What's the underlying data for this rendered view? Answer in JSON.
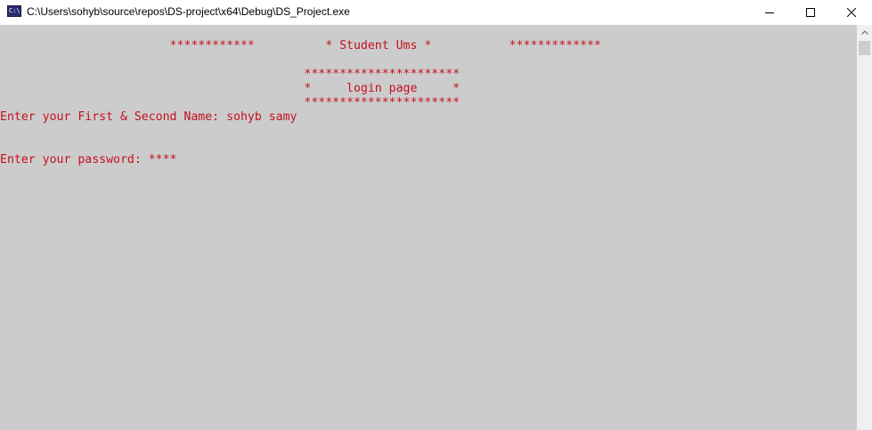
{
  "window": {
    "title": "C:\\Users\\sohyb\\source\\repos\\DS-project\\x64\\Debug\\DS_Project.exe",
    "icon_name": "console-app-icon",
    "icon_glyph": "C:\\"
  },
  "controls": {
    "minimize_icon": "minimize-icon",
    "maximize_icon": "maximize-icon",
    "close_icon": "close-icon"
  },
  "console": {
    "text_color": "#c50f1f",
    "background": "#cccccc",
    "header_line": "                        ************          * Student Ums *           *************",
    "box_top": "                                           **********************",
    "box_middle": "                                           *     login page     *",
    "box_bottom": "                                           **********************",
    "name_prompt": "Enter your First & Second Name: sohyb samy",
    "password_prompt": "Enter your password: ****"
  }
}
